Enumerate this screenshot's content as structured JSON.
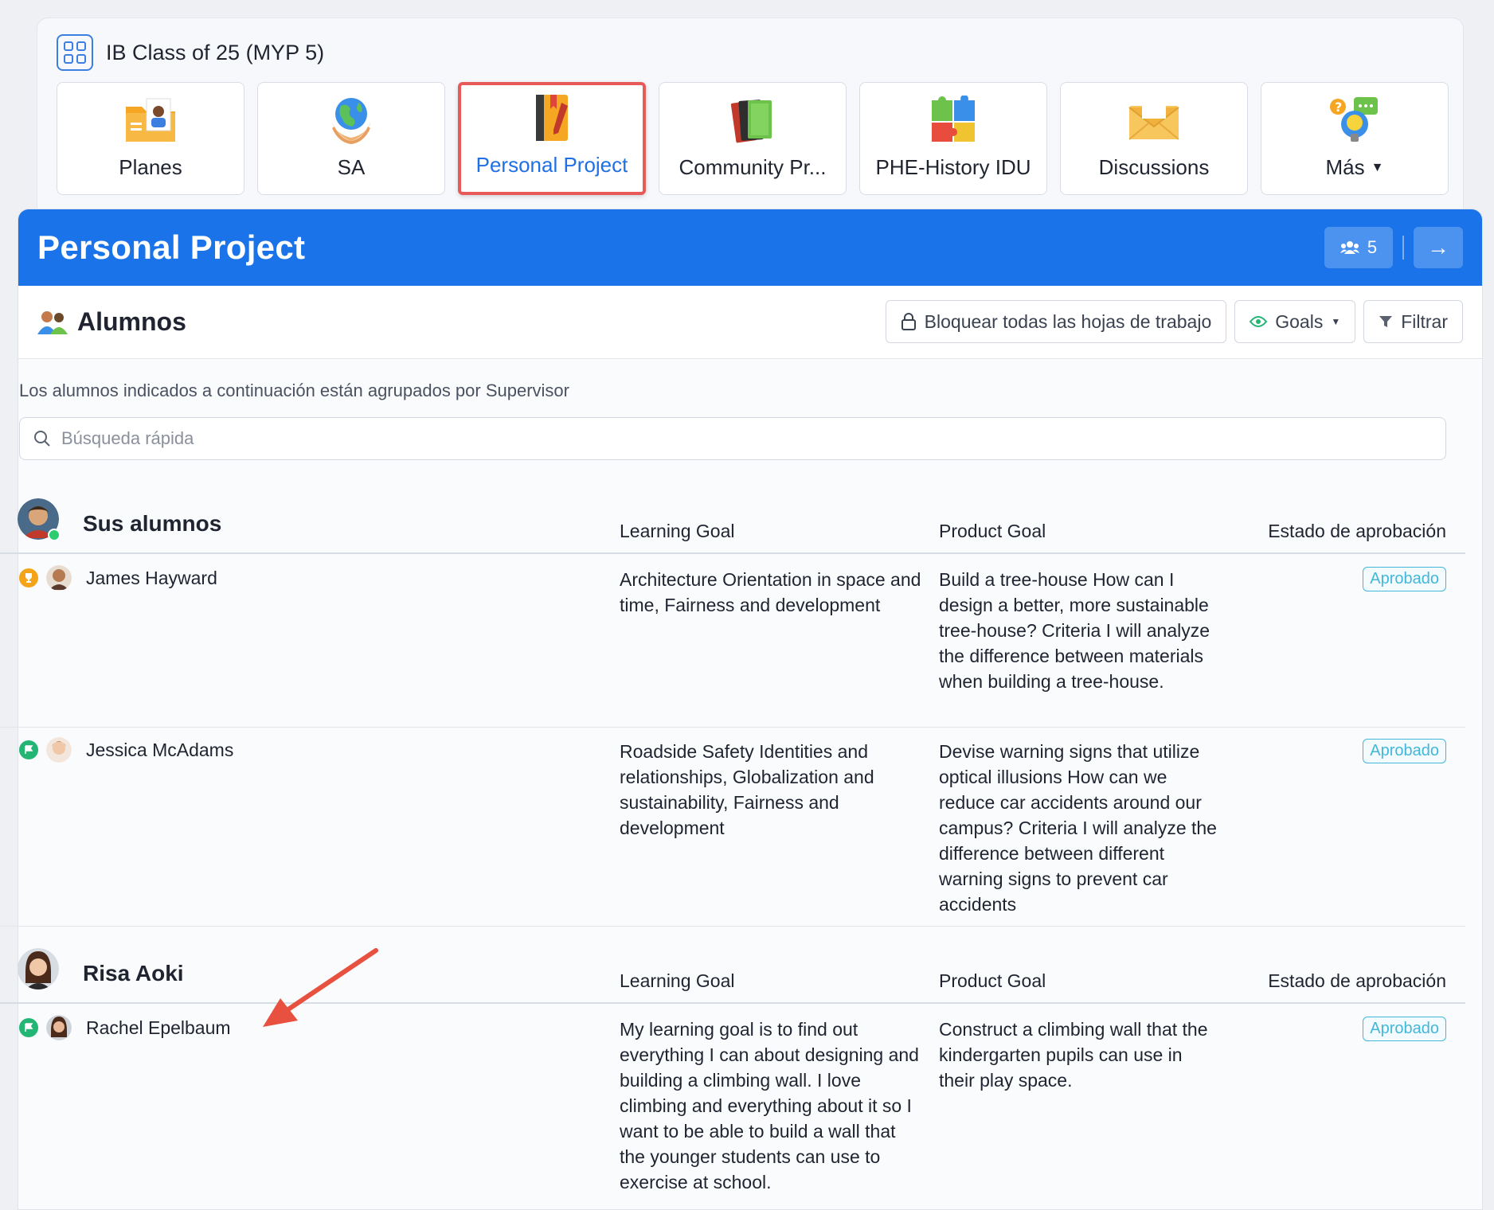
{
  "class": {
    "title": "IB Class of 25 (MYP 5)"
  },
  "tabs": [
    {
      "label": "Planes",
      "icon": "folder-person-icon"
    },
    {
      "label": "SA",
      "icon": "globe-hands-icon"
    },
    {
      "label": "Personal Project",
      "icon": "notebook-icon",
      "active": true
    },
    {
      "label": "Community Pr...",
      "icon": "books-icon"
    },
    {
      "label": "PHE-History IDU",
      "icon": "puzzle-icon"
    },
    {
      "label": "Discussions",
      "icon": "envelope-icon"
    },
    {
      "label": "Más",
      "icon": "bulb-chat-icon",
      "dropdown": true
    }
  ],
  "banner": {
    "title": "Personal Project",
    "count": "5"
  },
  "toolbar": {
    "title": "Alumnos",
    "lock_label": "Bloquear todas las hojas de trabajo",
    "goals_label": "Goals",
    "filter_label": "Filtrar"
  },
  "description": "Los alumnos indicados a continuación están agrupados por Supervisor",
  "search": {
    "placeholder": "Búsqueda rápida"
  },
  "columns": {
    "learning": "Learning Goal",
    "product": "Product Goal",
    "status": "Estado de aprobación"
  },
  "groups": [
    {
      "name": "Sus alumnos",
      "students": [
        {
          "name": "James Hayward",
          "status_icon": "trophy-icon",
          "learning_goal": "Architecture Orientation in space and time, Fairness and development",
          "product_goal": "Build a tree-house How can I design a better, more sustainable tree-house? Criteria I will analyze the difference between materials when building a tree-house.",
          "approval": "Aprobado"
        },
        {
          "name": "Jessica McAdams",
          "status_icon": "flag-icon",
          "learning_goal": "Roadside Safety Identities and relationships, Globalization and sustainability, Fairness and development",
          "product_goal": "Devise warning signs that utilize optical illusions How can we reduce car accidents around our campus? Criteria I will analyze the difference between different warning signs to prevent car accidents",
          "approval": "Aprobado"
        }
      ]
    },
    {
      "name": "Risa Aoki",
      "students": [
        {
          "name": "Rachel Epelbaum",
          "status_icon": "flag-icon",
          "learning_goal": "My learning goal is to find out everything I can about designing and building a climbing wall. I love climbing and everything about it so I want to be able to build a wall that the younger students can use to exercise at school.",
          "product_goal": "Construct a climbing wall that the kindergarten pupils can use in their play space.",
          "approval": "Aprobado"
        }
      ]
    }
  ],
  "colors": {
    "accent": "#1a73e8",
    "highlight": "#e85a57",
    "approved": "#43b7d8"
  }
}
